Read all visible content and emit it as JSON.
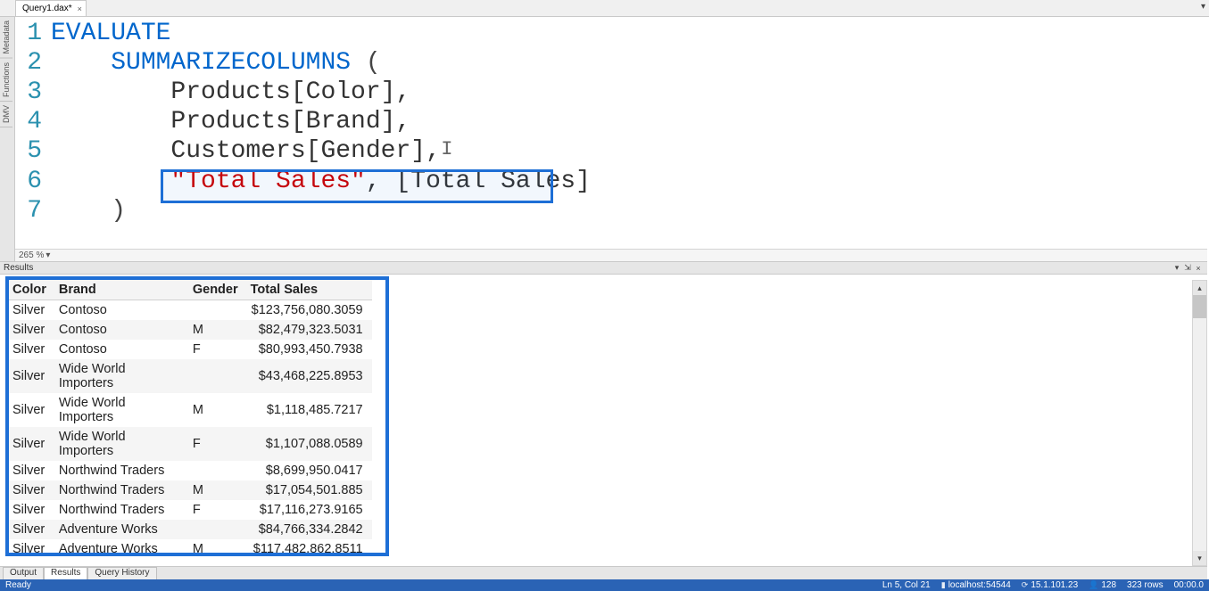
{
  "tab_strip": {
    "file_name": "Query1.dax*",
    "close_glyph": "×",
    "popup_glyph": "▾"
  },
  "side_tabs": [
    "Metadata",
    "Functions",
    "DMV"
  ],
  "editor": {
    "zoom": "265 %",
    "zoom_glyph": "▾",
    "cursor_glyph": "I",
    "lines": {
      "l1_kw": "EVALUATE",
      "l2_indent": "    ",
      "l2_fn": "SUMMARIZECOLUMNS",
      "l2_rest": " (",
      "l3": "        Products[Color],",
      "l4": "        Products[Brand],",
      "l5": "        Customers[Gender],",
      "l6_indent": "        ",
      "l6_str": "\"Total Sales\"",
      "l6_mid": ", ",
      "l6_ref": "[Total Sales]",
      "l7": "    )",
      "gutter": [
        "1",
        "2",
        "3",
        "4",
        "5",
        "6",
        "7"
      ]
    }
  },
  "results": {
    "title": "Results",
    "pin_glyph": "▾",
    "dock_glyph": "⇲",
    "close_glyph": "×",
    "columns": [
      "Color",
      "Brand",
      "Gender",
      "Total Sales"
    ],
    "rows": [
      {
        "color": "Silver",
        "brand": "Contoso",
        "gender": "",
        "sales": "$123,756,080.3059"
      },
      {
        "color": "Silver",
        "brand": "Contoso",
        "gender": "M",
        "sales": "$82,479,323.5031"
      },
      {
        "color": "Silver",
        "brand": "Contoso",
        "gender": "F",
        "sales": "$80,993,450.7938"
      },
      {
        "color": "Silver",
        "brand": "Wide World Importers",
        "gender": "",
        "sales": "$43,468,225.8953"
      },
      {
        "color": "Silver",
        "brand": "Wide World Importers",
        "gender": "M",
        "sales": "$1,118,485.7217"
      },
      {
        "color": "Silver",
        "brand": "Wide World Importers",
        "gender": "F",
        "sales": "$1,107,088.0589"
      },
      {
        "color": "Silver",
        "brand": "Northwind Traders",
        "gender": "",
        "sales": "$8,699,950.0417"
      },
      {
        "color": "Silver",
        "brand": "Northwind Traders",
        "gender": "M",
        "sales": "$17,054,501.885"
      },
      {
        "color": "Silver",
        "brand": "Northwind Traders",
        "gender": "F",
        "sales": "$17,116,273.9165"
      },
      {
        "color": "Silver",
        "brand": "Adventure Works",
        "gender": "",
        "sales": "$84,766,334.2842"
      },
      {
        "color": "Silver",
        "brand": "Adventure Works",
        "gender": "M",
        "sales": "$117,482,862.8511"
      }
    ],
    "scroll_up_glyph": "▴",
    "scroll_dn_glyph": "▾"
  },
  "bottom_tabs": {
    "output": "Output",
    "results": "Results",
    "history": "Query History"
  },
  "status": {
    "ready": "Ready",
    "cursor": "Ln 5, Col 21",
    "server_icon": "▮",
    "server": "localhost:54544",
    "db_icon": "⟳",
    "version": "15.1.101.23",
    "user_icon": "👤",
    "user": "128",
    "rows": "323 rows",
    "time": "00:00.0"
  }
}
